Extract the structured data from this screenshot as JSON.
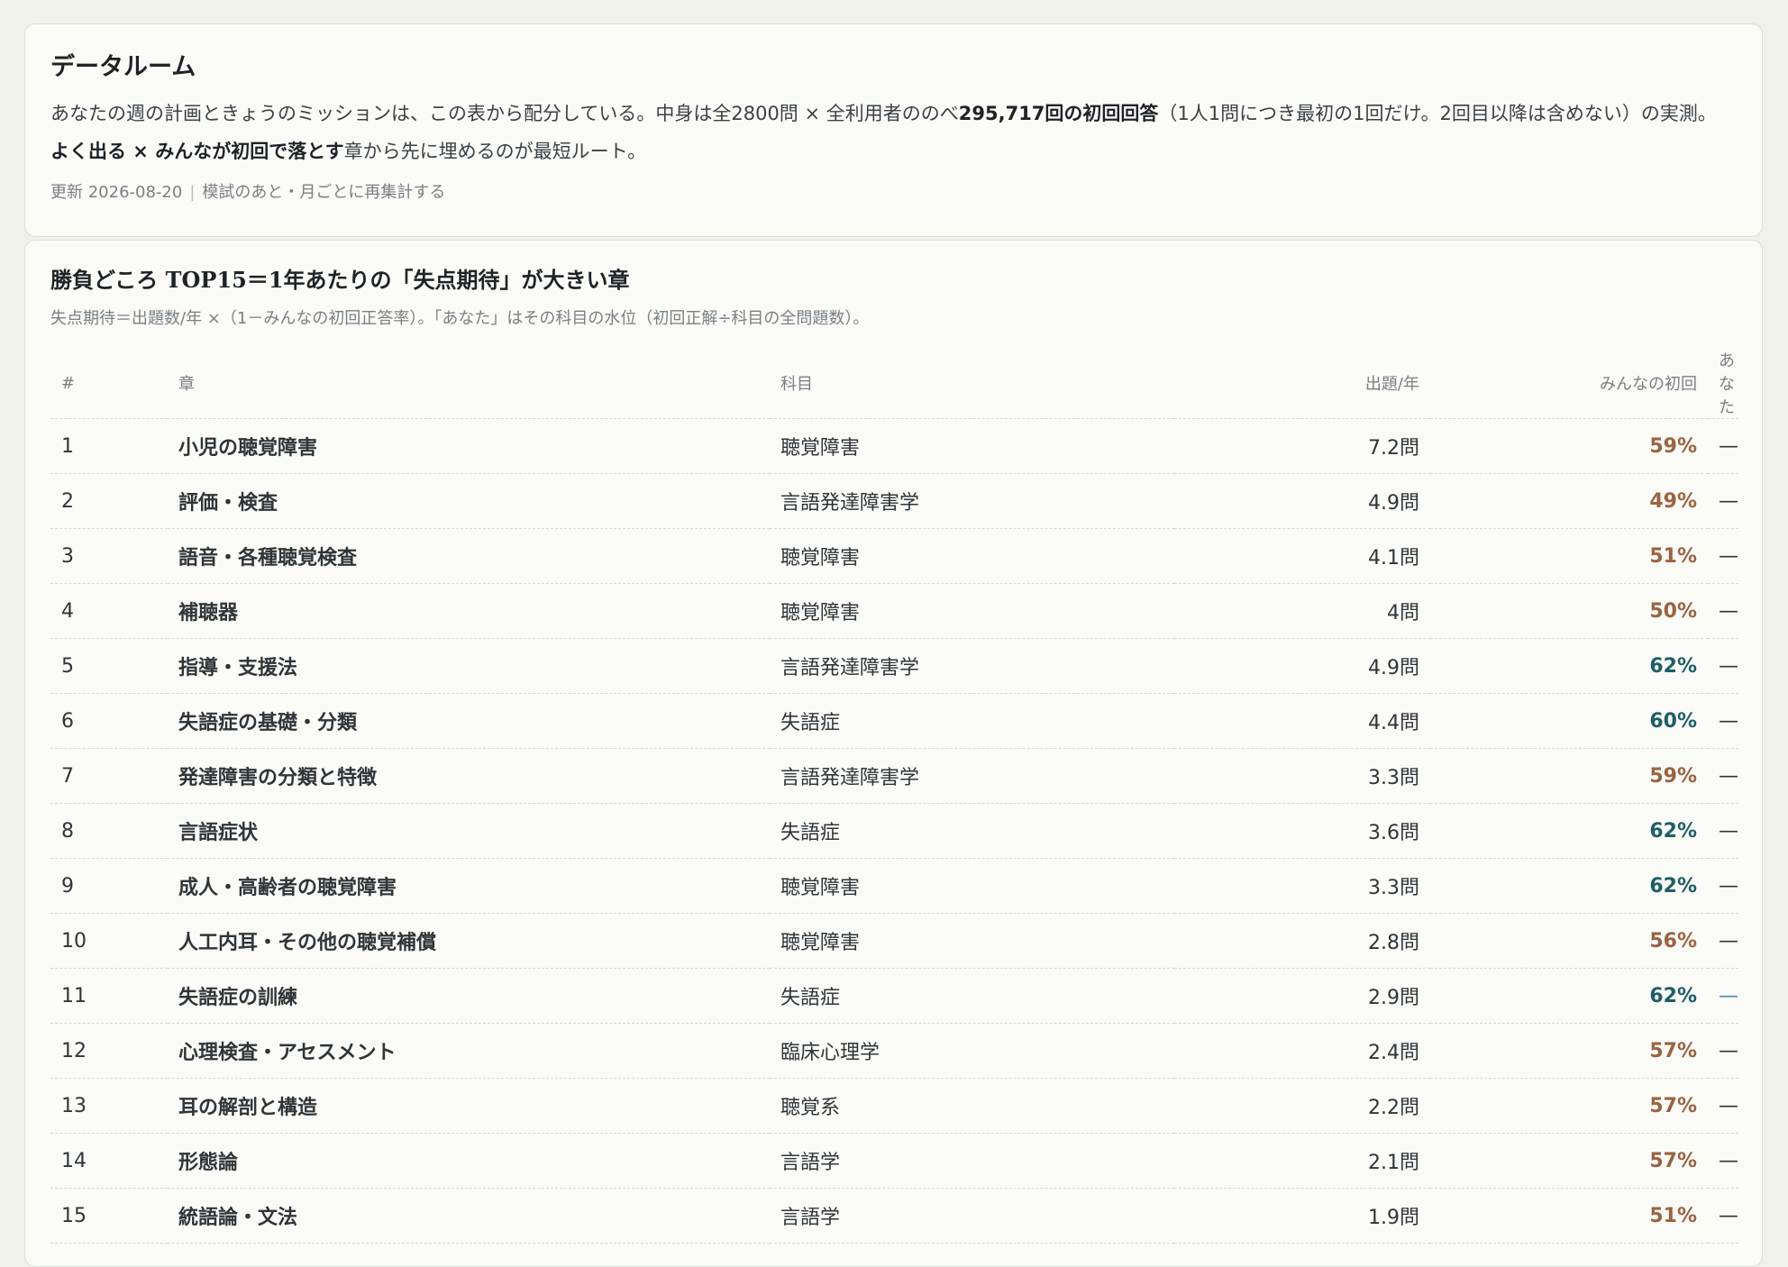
{
  "intro": {
    "title": "データルーム",
    "text_1": "あなたの週の計画ときょうのミッションは、この表から配分している。中身は全2800問 × 全利用者ののべ",
    "text_bold_1": "295,717回の初回回答",
    "text_2": "（1人1問につき最初の1回だけ。2回目以降は含めない）の実測。",
    "text_bold_2": "よく出る × みんなが初回で落とす",
    "text_3": "章から先に埋めるのが最短ルート。",
    "updated": "更新 2026-08-20",
    "separator": "|",
    "schedule": "模試のあと・月ごとに再集計する"
  },
  "table_section": {
    "title": "勝負どころ TOP15＝1年あたりの「失点期待」が大きい章",
    "subtitle": "失点期待＝出題数/年 ×（1－みんなの初回正答率）。「あなた」はその科目の水位（初回正解÷科目の全問題数）。",
    "headers": {
      "num": "#",
      "chapter": "章",
      "subject": "科目",
      "freq": "出題/年",
      "rate": "みんなの初回",
      "you": "あなた"
    },
    "rows": [
      {
        "num": "1",
        "chapter": "小児の聴覚障害",
        "subject": "聴覚障害",
        "freq": "7.2問",
        "rate": "59%",
        "you": "—"
      },
      {
        "num": "2",
        "chapter": "評価・検査",
        "subject": "言語発達障害学",
        "freq": "4.9問",
        "rate": "49%",
        "you": "—"
      },
      {
        "num": "3",
        "chapter": "語音・各種聴覚検査",
        "subject": "聴覚障害",
        "freq": "4.1問",
        "rate": "51%",
        "you": "—"
      },
      {
        "num": "4",
        "chapter": "補聴器",
        "subject": "聴覚障害",
        "freq": "4問",
        "rate": "50%",
        "you": "—"
      },
      {
        "num": "5",
        "chapter": "指導・支援法",
        "subject": "言語発達障害学",
        "freq": "4.9問",
        "rate": "62%",
        "you": "—"
      },
      {
        "num": "6",
        "chapter": "失語症の基礎・分類",
        "subject": "失語症",
        "freq": "4.4問",
        "rate": "60%",
        "you": "—"
      },
      {
        "num": "7",
        "chapter": "発達障害の分類と特徴",
        "subject": "言語発達障害学",
        "freq": "3.3問",
        "rate": "59%",
        "you": "—"
      },
      {
        "num": "8",
        "chapter": "言語症状",
        "subject": "失語症",
        "freq": "3.6問",
        "rate": "62%",
        "you": "—"
      },
      {
        "num": "9",
        "chapter": "成人・高齢者の聴覚障害",
        "subject": "聴覚障害",
        "freq": "3.3問",
        "rate": "62%",
        "you": "—"
      },
      {
        "num": "10",
        "chapter": "人工内耳・その他の聴覚補償",
        "subject": "聴覚障害",
        "freq": "2.8問",
        "rate": "56%",
        "you": "—"
      },
      {
        "num": "11",
        "chapter": "失語症の訓練",
        "subject": "失語症",
        "freq": "2.9問",
        "rate": "62%",
        "you": "—"
      },
      {
        "num": "12",
        "chapter": "心理検査・アセスメント",
        "subject": "臨床心理学",
        "freq": "2.4問",
        "rate": "57%",
        "you": "—"
      },
      {
        "num": "13",
        "chapter": "耳の解剖と構造",
        "subject": "聴覚系",
        "freq": "2.2問",
        "rate": "57%",
        "you": "—"
      },
      {
        "num": "14",
        "chapter": "形態論",
        "subject": "言語学",
        "freq": "2.1問",
        "rate": "57%",
        "you": "—"
      },
      {
        "num": "15",
        "chapter": "統語論・文法",
        "subject": "言語学",
        "freq": "1.9問",
        "rate": "51%",
        "you": "—"
      }
    ]
  },
  "colors": {
    "chapter_link": "#1f5e66",
    "rate_low": "#9a6341",
    "rate_mid": "#1f5e66",
    "you_dash": "#a4a9a9",
    "you_dash_active": "#4f86a8"
  }
}
